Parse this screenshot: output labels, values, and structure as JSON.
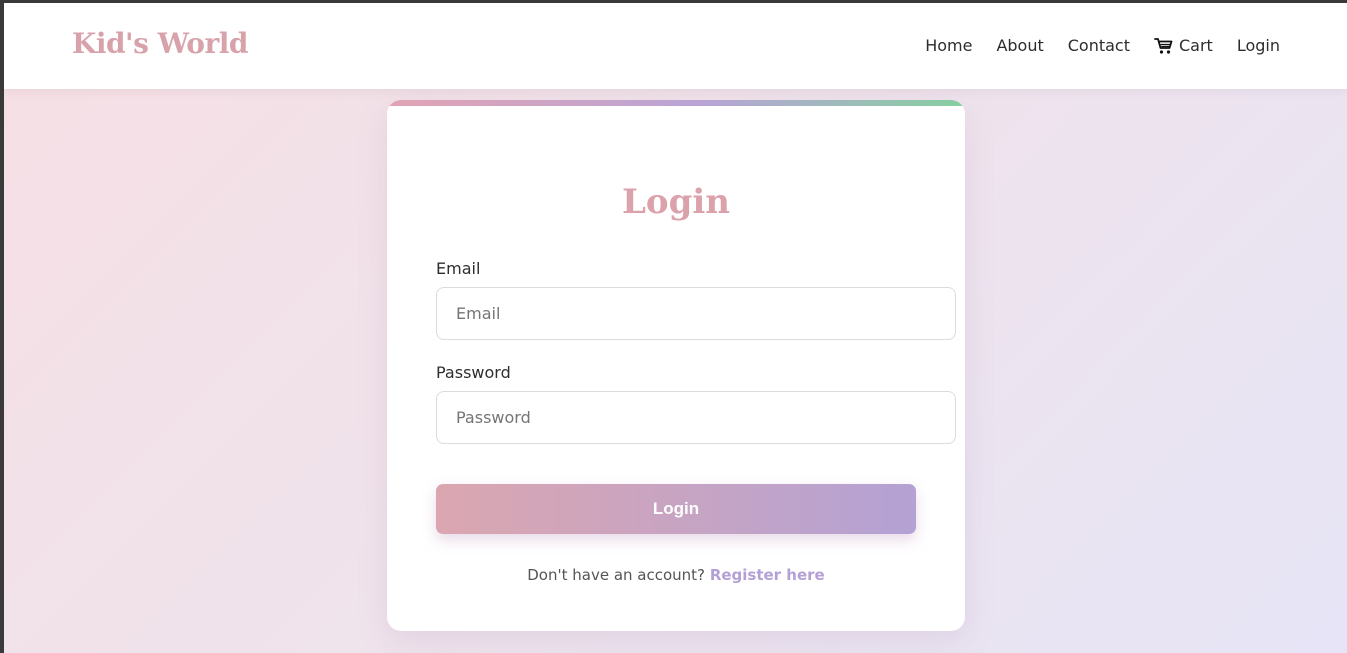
{
  "brand": {
    "name": "Kid's World"
  },
  "nav": {
    "items": [
      {
        "label": "Home"
      },
      {
        "label": "About"
      },
      {
        "label": "Contact"
      },
      {
        "label": "Cart",
        "icon": "cart-icon"
      },
      {
        "label": "Login"
      }
    ]
  },
  "login_form": {
    "title": "Login",
    "email": {
      "label": "Email",
      "placeholder": "Email",
      "value": ""
    },
    "password": {
      "label": "Password",
      "placeholder": "Password",
      "value": ""
    },
    "submit_label": "Login",
    "register_prompt": "Don't have an account?",
    "register_link": "Register here"
  },
  "colors": {
    "brand": "#d8a2ab",
    "accent_purple": "#b3a0d6",
    "accent_green": "#85cfa0",
    "button_start": "#dba6b0",
    "button_end": "#b4a2d4"
  }
}
